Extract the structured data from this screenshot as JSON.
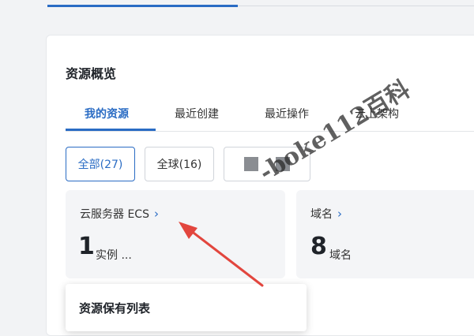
{
  "section": {
    "title": "资源概览"
  },
  "tabs": [
    {
      "label": "我的资源",
      "active": true
    },
    {
      "label": "最近创建"
    },
    {
      "label": "最近操作"
    },
    {
      "label": "云上架构"
    }
  ],
  "filters": [
    {
      "label": "全部(27)",
      "active": true
    },
    {
      "label": "全球(16)"
    },
    {
      "label": "",
      "icon": "redacted-blocks-icon"
    }
  ],
  "stats": [
    {
      "label": "云服务器 ECS",
      "value": "1",
      "unit": "实例 ..."
    },
    {
      "label": "域名",
      "value": "8",
      "unit": "域名"
    }
  ],
  "popup": {
    "title": "资源保有列表"
  },
  "watermark": {
    "text": "-boke112百科"
  },
  "colors": {
    "accent": "#2a6cc4",
    "annotation_arrow": "#e2463e"
  }
}
